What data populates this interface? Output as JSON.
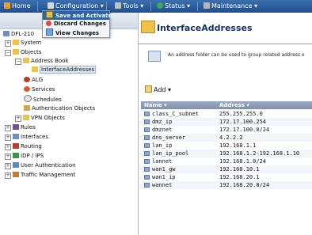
{
  "menubar": {
    "items": [
      {
        "label": "Home",
        "icon": "home-icon",
        "color": "#e8a02a"
      },
      {
        "label": "Configuration ▾",
        "icon": "configuration-icon",
        "color": "#d9d9d9"
      },
      {
        "label": "Tools ▾",
        "icon": "tools-icon",
        "color": "#c0c0c0"
      },
      {
        "label": "Status ▾",
        "icon": "status-icon",
        "color": "#3aa757"
      },
      {
        "label": "Maintenance ▾",
        "icon": "maintenance-icon",
        "color": "#b7b7b7"
      }
    ]
  },
  "dropdown": {
    "items": [
      {
        "label": "Save and Activate",
        "selected": true,
        "icon": "save-icon"
      },
      {
        "label": "Discard Changes",
        "selected": false,
        "icon": "discard-icon"
      },
      {
        "label": "View Changes",
        "selected": false,
        "icon": "view-icon"
      }
    ]
  },
  "tree": {
    "root": "DFL-210",
    "system": "System",
    "objects": "Objects",
    "address_book": "Address Book",
    "interface_addresses": "InterfaceAddresses",
    "alg": "ALG",
    "services": "Services",
    "schedules": "Schedules",
    "auth_objects": "Authentication Objects",
    "vpn_objects": "VPN Objects",
    "rules": "Rules",
    "interfaces": "Interfaces",
    "routing": "Routing",
    "idp_ips": "IDP / IPS",
    "user_auth": "User Authentication",
    "traffic_mgmt": "Traffic Management"
  },
  "main": {
    "title": "InterfaceAddresses",
    "description": "An address folder can be used to group related address o",
    "add_label": "Add ▾",
    "columns": {
      "name": "Name ▾",
      "address": "Address ▾"
    },
    "rows": [
      {
        "name": "class_C_subnet",
        "address": "255.255.255.0"
      },
      {
        "name": "dmz_ip",
        "address": "172.17.100.254"
      },
      {
        "name": "dmznet",
        "address": "172.17.100.0/24"
      },
      {
        "name": "dns_server",
        "address": "4.2.2.2"
      },
      {
        "name": "lan_ip",
        "address": "192.168.1.1"
      },
      {
        "name": "lan_ip_pool",
        "address": "192.168.1.2-192.168.1.10"
      },
      {
        "name": "lannet",
        "address": "192.168.1.0/24"
      },
      {
        "name": "wan1_gw",
        "address": "192.168.10.1"
      },
      {
        "name": "wan1_ip",
        "address": "192.168.20.1"
      },
      {
        "name": "wannet",
        "address": "192.168.20.0/24"
      }
    ]
  },
  "colors": {
    "menubar": "#2a5c9e",
    "accent": "#2e63a8",
    "title": "#13346b"
  }
}
